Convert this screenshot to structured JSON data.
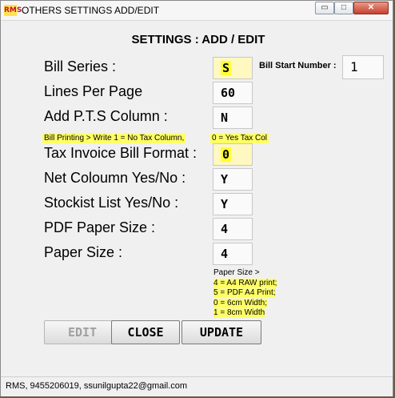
{
  "window": {
    "title": "OTHERS SETTINGS ADD/EDIT",
    "app_icon_text": "RMS",
    "controls": {
      "minimize": "▭",
      "maximize": "□",
      "close": "✕"
    }
  },
  "heading": "SETTINGS : ADD / EDIT",
  "fields": [
    {
      "label": "Bill Series :",
      "value": "S"
    },
    {
      "label": "Lines Per Page",
      "value": "60"
    },
    {
      "label": "Add P.T.S Column :",
      "value": "N"
    },
    {
      "label": "Tax Invoice Bill Format :",
      "value": "0"
    },
    {
      "label": "Net Coloumn Yes/No :",
      "value": "Y"
    },
    {
      "label": "Stockist List Yes/No :",
      "value": "Y"
    },
    {
      "label": "PDF Paper Size :",
      "value": "4"
    },
    {
      "label": "Paper Size :",
      "value": "4"
    }
  ],
  "bill_start": {
    "label": "Bill Start Number :",
    "value": "1"
  },
  "notes": {
    "bill_printing_left": "Bill Printing > Write 1 = No Tax Column,",
    "bill_printing_right": "0 = Yes Tax Col",
    "paper_size_lines": [
      "Paper Size >",
      "4 = A4 RAW print;",
      "5 = PDF A4 Print;",
      "0 = 6cm Width;",
      "1 = 8cm Width"
    ]
  },
  "buttons": {
    "edit": "EDIT",
    "close": "CLOSE",
    "update": "UPDATE"
  },
  "status": "RMS, 9455206019, ssunilgupta22@gmail.com",
  "colors": {
    "highlight": "#ffff66",
    "window_bg": "#f0f0f0",
    "close_button": "#c7402c"
  }
}
